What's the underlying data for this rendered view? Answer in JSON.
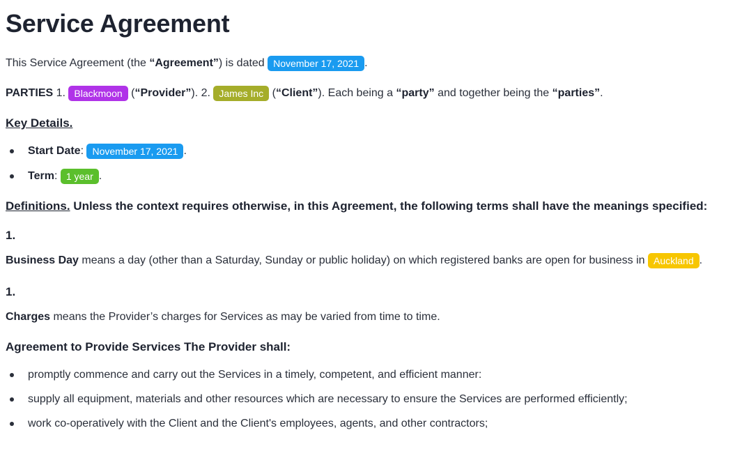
{
  "title": "Service Agreement",
  "intro": {
    "pre": "This Service Agreement (the ",
    "agreement_term": "“Agreement”",
    "mid": ") is dated ",
    "date": "November 17, 2021",
    "end": "."
  },
  "parties": {
    "label": "PARTIES",
    "n1": " 1. ",
    "provider_name": "Blackmoon",
    "provider_pre": " (",
    "provider_term": "“Provider”",
    "n2": "). 2. ",
    "client_name": "James Inc",
    "client_pre": " (",
    "client_term": "“Client”",
    "each": "). Each being a ",
    "party_term": "“party”",
    "together": " and together being the ",
    "parties_term": "“parties”",
    "end": "."
  },
  "key_details": {
    "heading": "Key Details.",
    "start_label": "Start Date",
    "start_colon": ": ",
    "start_value": "November 17, 2021",
    "start_end": ".",
    "term_label": "Term",
    "term_colon": ": ",
    "term_value": "1 year",
    "term_end": "."
  },
  "definitions": {
    "heading": "Definitions.",
    "text": " Unless the context requires otherwise, in this Agreement, the following terms shall have the meanings specified:",
    "items": [
      {
        "number": "1.",
        "term": "Business Day",
        "text": " means a day (other than a Saturday, Sunday or public holiday) on which registered banks are open for business in ",
        "location": "Auckland",
        "end": "."
      },
      {
        "number": "1.",
        "term": "Charges",
        "text": " means the Provider’s charges for Services as may be varied from time to time."
      }
    ]
  },
  "provide_services": {
    "heading": "Agreement to Provide Services",
    "text": " The Provider shall:",
    "items": [
      "promptly commence and carry out the Services in a timely, competent, and efficient manner:",
      "supply all equipment, materials and other resources which are necessary to ensure the Services are performed efficiently;",
      "work co-operatively with the Client and the Client's employees, agents, and other contractors;"
    ]
  },
  "colors": {
    "date_pill": "#1a9bf0",
    "provider_pill": "#b033e8",
    "client_pill": "#a5ad2a",
    "term_pill": "#5bbf2c",
    "location_pill": "#f7c600"
  }
}
